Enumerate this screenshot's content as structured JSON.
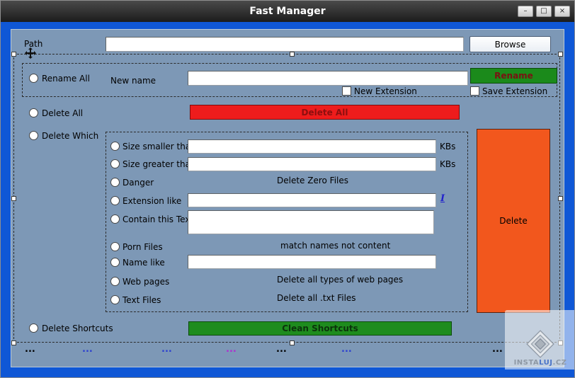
{
  "window": {
    "title": "Fast Manager",
    "minimize": "–",
    "maximize": "□",
    "close": "×"
  },
  "colors": {
    "frame_blue": "#0f57d6",
    "panel": "#7d98b6",
    "green": "#1b8a1b",
    "red": "#ee1c1c",
    "orange": "#f2571d",
    "clean_green": "#1e8c1e"
  },
  "path": {
    "label": "Path",
    "value": "",
    "browse_label": "Browse"
  },
  "rename": {
    "radio_label": "Rename All",
    "field_label": "New name",
    "value": "",
    "button_label": "Rename",
    "checkbox_new": "New Extension",
    "checkbox_save": "Save Extension"
  },
  "delete_all": {
    "radio_label": "Delete All",
    "button_label": "Delete All"
  },
  "delete_which": {
    "radio_label": "Delete Which",
    "rows": {
      "size_smaller": {
        "label": "Size smaller than",
        "unit": "KBs",
        "value": ""
      },
      "size_greater": {
        "label": "Size greater than",
        "unit": "KBs",
        "value": ""
      },
      "danger": {
        "label": "Danger",
        "info": "Delete Zero Files"
      },
      "extension": {
        "label": "Extension like",
        "link": "I",
        "value": ""
      },
      "contain": {
        "label": "Contain this Text",
        "value": ""
      },
      "porn": {
        "label": "Porn Files",
        "info": "match names not  content"
      },
      "name_like": {
        "label": "Name like",
        "value": ""
      },
      "web": {
        "label": "Web pages",
        "info": "Delete all types of web pages"
      },
      "text_files": {
        "label": "Text Files",
        "info": "Delete all .txt Files"
      }
    },
    "delete_button_label": "Delete"
  },
  "shortcuts": {
    "radio_label": "Delete Shortcuts",
    "button_label": "Clean Shortcuts"
  },
  "status": {
    "items": [
      {
        "text": "...",
        "css": "color:#000000"
      },
      {
        "text": "...",
        "css": "color:#2b3fd0"
      },
      {
        "text": "...",
        "css": "color:#2b3fd0"
      },
      {
        "text": "...",
        "css": "color:#b02bd0"
      },
      {
        "text": "...",
        "css": "color:#000000"
      },
      {
        "text": "...",
        "css": "color:#2b3fd0"
      },
      {
        "text": "...",
        "css": "color:#000000"
      }
    ]
  },
  "watermark": {
    "part1": "INSTA",
    "part2": "LUJ",
    "part3": ".CZ"
  }
}
